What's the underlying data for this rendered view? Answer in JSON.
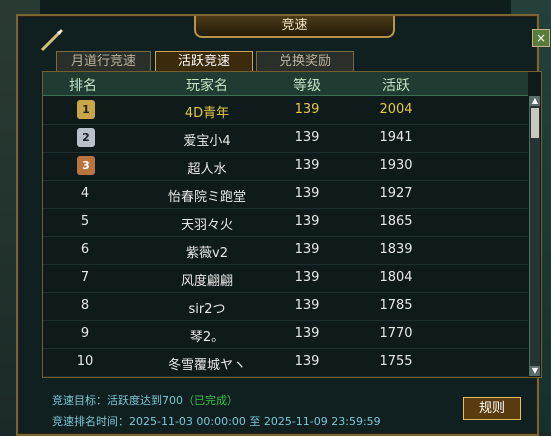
{
  "window": {
    "title": "竞速"
  },
  "tabs": [
    {
      "label": "月道行竞速"
    },
    {
      "label": "活跃竞速"
    },
    {
      "label": "兑换奖励"
    }
  ],
  "table": {
    "headers": [
      "排名",
      "玩家名",
      "等级",
      "活跃"
    ],
    "rows": [
      {
        "rank": "1",
        "name": "4D青年",
        "level": "139",
        "active": "2004"
      },
      {
        "rank": "2",
        "name": "爱宝小4",
        "level": "139",
        "active": "1941"
      },
      {
        "rank": "3",
        "name": "超人水",
        "level": "139",
        "active": "1930"
      },
      {
        "rank": "4",
        "name": "怡春院ミ跑堂",
        "level": "139",
        "active": "1927"
      },
      {
        "rank": "5",
        "name": "天羽々火",
        "level": "139",
        "active": "1865"
      },
      {
        "rank": "6",
        "name": "紫薇v2",
        "level": "139",
        "active": "1839"
      },
      {
        "rank": "7",
        "name": "风度翩翩",
        "level": "139",
        "active": "1804"
      },
      {
        "rank": "8",
        "name": "sir2つ",
        "level": "139",
        "active": "1785"
      },
      {
        "rank": "9",
        "name": "琴2。",
        "level": "139",
        "active": "1770"
      },
      {
        "rank": "10",
        "name": "冬雪覆城ヤヽ",
        "level": "139",
        "active": "1755"
      }
    ]
  },
  "footer": {
    "goal_label": "竞速目标：",
    "goal_text": "活跃度达到700",
    "goal_status": "（已完成）",
    "time_label": "竞速排名时间：",
    "time_value": "2025-11-03 00:00:00 至 2025-11-09 23:59:59"
  },
  "buttons": {
    "rules": "规则",
    "close": "×"
  }
}
